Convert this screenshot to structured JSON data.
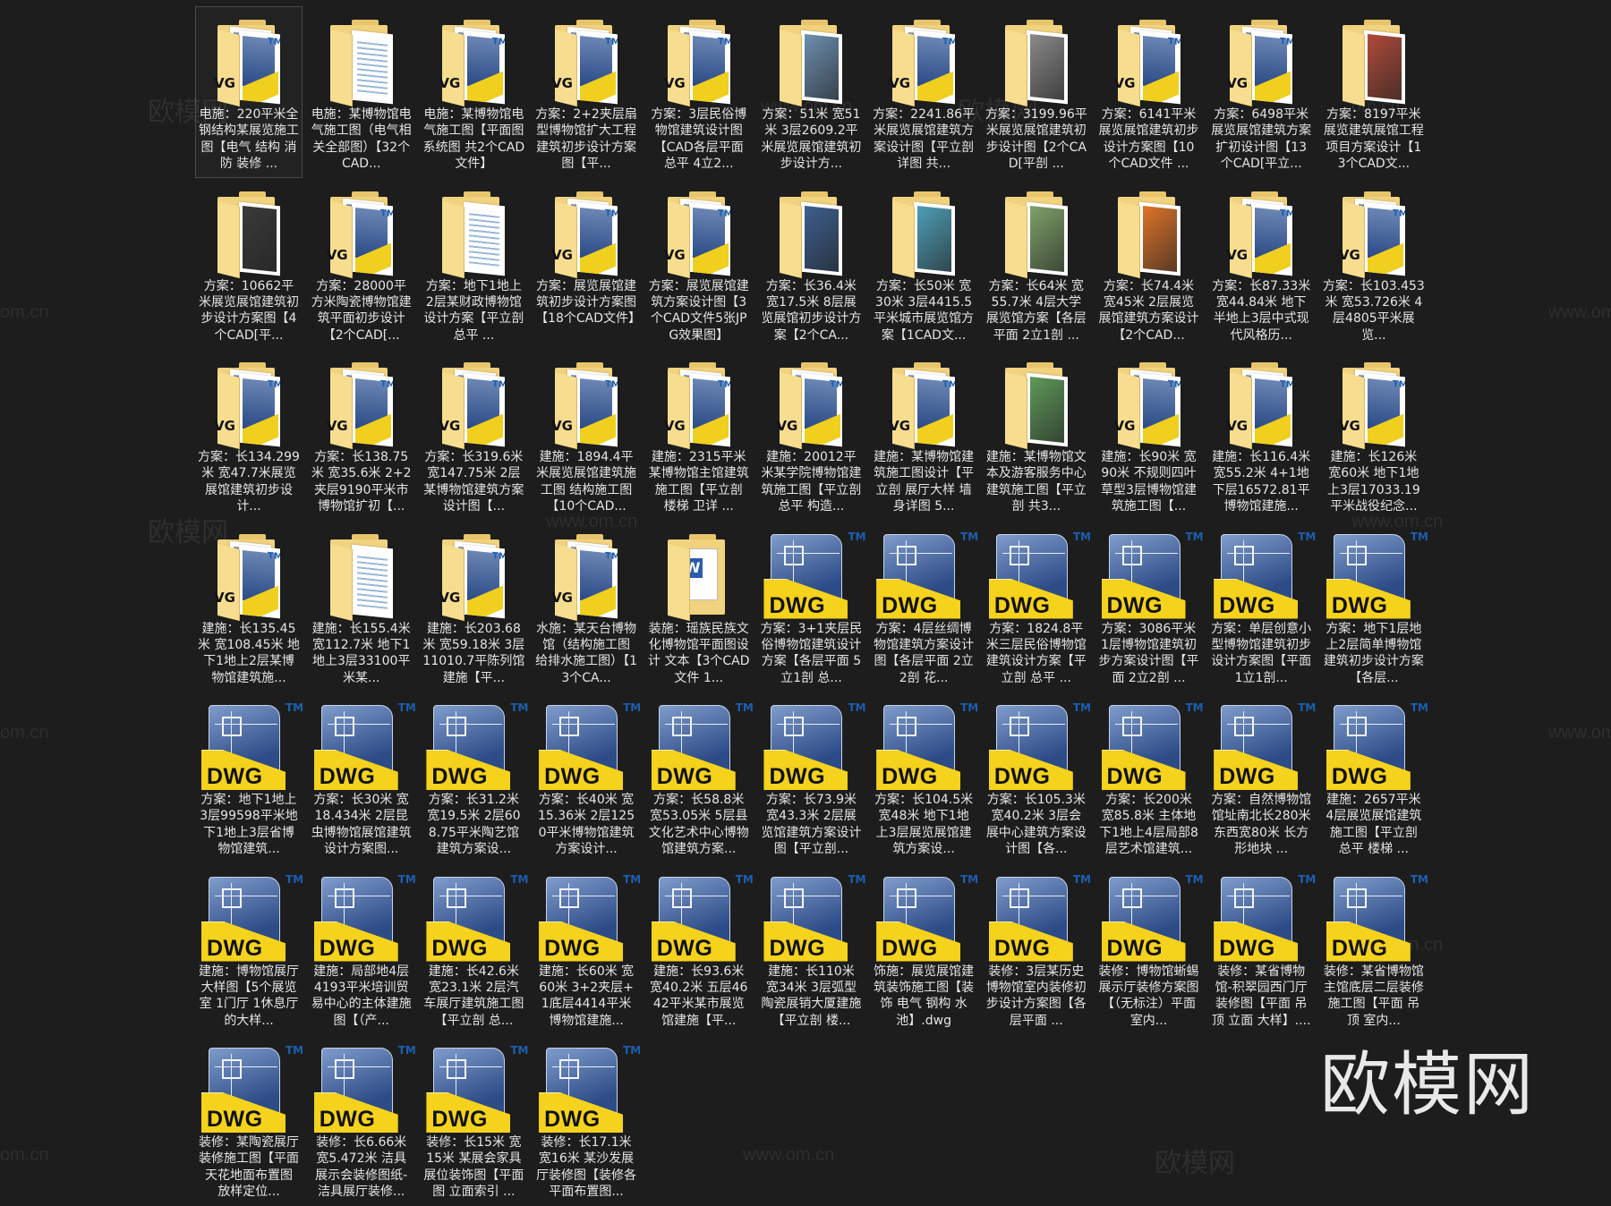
{
  "icon_text": {
    "dwg": "DWG",
    "vg": "VG",
    "tm": "TM",
    "word": "W"
  },
  "watermarks": {
    "url": "www.om.cn",
    "url_short": "om.cn",
    "brand": "欧模网"
  },
  "colors": {
    "background": "#1d1d1d",
    "label": "#e6e6e6",
    "folder": "#f0d27f",
    "dwg_blue": "#2d4b86",
    "dwg_yellow": "#f5d21c"
  },
  "selected_index": 0,
  "items": [
    {
      "type": "dwg-folder",
      "label": "电施：220平米全钢结构某展览施工图【电气 结构 消防 装修 ..."
    },
    {
      "type": "doc-folder",
      "label": "电施：某博物馆电气施工图（电气相关全部图）【32个CAD..."
    },
    {
      "type": "dwg-folder",
      "label": "电施：某博物馆电气施工图【平面图 系统图 共2个CAD文件】"
    },
    {
      "type": "dwg-folder",
      "label": "方案：2+2夹层扇型博物馆扩大工程建筑初步设计方案图【平..."
    },
    {
      "type": "dwg-folder",
      "label": "方案：3层民俗博物馆建筑设计图【CAD各层平面 总平 4立2..."
    },
    {
      "type": "image-folder",
      "preview": "#6d8fb0",
      "label": "方案：51米 宽51米 3层2609.2平米展览展馆建筑初步设计方..."
    },
    {
      "type": "dwg-folder",
      "label": "方案：2241.86平米展览展馆建筑方案设计图【平立剖 详图 共..."
    },
    {
      "type": "image-folder",
      "preview": "#8a8a8a",
      "label": "方案：3199.96平米展览展馆建筑初步设计图【2个CAD[平剖 ..."
    },
    {
      "type": "dwg-folder",
      "label": "方案：6141平米展览展馆建筑初步设计方案图【10个CAD文件 ..."
    },
    {
      "type": "dwg-folder",
      "label": "方案：6498平米展览展馆建筑方案扩初设计图【13个CAD[平立..."
    },
    {
      "type": "image-folder",
      "preview": "#b04a3a",
      "label": "方案：8197平米展览建筑展馆工程项目方案设计【13个CAD文..."
    },
    {
      "type": "image-folder",
      "preview": "#3a3a3a",
      "label": "方案：10662平米展览展馆建筑初步设计方案图【4个CAD[平..."
    },
    {
      "type": "dwg-folder",
      "label": "方案：28000平方米陶瓷博物馆建筑平面初步设计【2个CAD[..."
    },
    {
      "type": "doc-folder",
      "label": "方案：地下1地上2层某财政博物馆设计方案【平立剖 总平 ..."
    },
    {
      "type": "dwg-folder",
      "label": "方案：展览展馆建筑初步设计方案图【18个CAD文件】"
    },
    {
      "type": "dwg-folder",
      "label": "方案：展览展馆建筑方案设计图【3个CAD文件5张JPG效果图】"
    },
    {
      "type": "image-folder",
      "preview": "#3d5f8f",
      "label": "方案：长36.4米 宽17.5米 8层展览展馆初步设计方案【2个CA..."
    },
    {
      "type": "image-folder",
      "preview": "#4f9fb8",
      "label": "方案：长50米 宽30米 3层4415.5平米城市展览馆方案【1CAD文..."
    },
    {
      "type": "image-folder",
      "preview": "#7fa36a",
      "label": "方案：长64米 宽55.7米 4层大学展览馆方案【各层平面 2立1剖 ..."
    },
    {
      "type": "image-folder",
      "preview": "#e0742a",
      "label": "方案：长74.4米 宽45米 2层展览展馆建筑方案设计【2个CAD..."
    },
    {
      "type": "dwg-folder",
      "label": "方案：长87.33米 宽44.84米 地下半地上3层中式现代风格历..."
    },
    {
      "type": "dwg-folder",
      "label": "方案：长103.453米 宽53.726米 4层4805平米展览..."
    },
    {
      "type": "dwg-folder",
      "label": "方案：长134.299米 宽47.7米展览展馆建筑初步设计..."
    },
    {
      "type": "dwg-folder",
      "label": "方案：长138.75米 宽35.6米 2+2夹层9190平米市博物馆扩初【..."
    },
    {
      "type": "dwg-folder",
      "label": "方案：长319.6米 宽147.75米 2层某博物馆建筑方案设计图【..."
    },
    {
      "type": "dwg-folder",
      "label": "建施：1894.4平米展览展馆建筑施工图 结构施工图【10个CAD..."
    },
    {
      "type": "dwg-folder",
      "label": "建施：2315平米某博物馆主馆建筑施工图【平立剖 楼梯 卫详 ..."
    },
    {
      "type": "dwg-folder",
      "label": "建施：20012平米某学院博物馆建筑施工图【平立剖 总平 构造..."
    },
    {
      "type": "dwg-folder",
      "label": "建施：某博物馆建筑施工图设计【平立剖 展厅大样 墙身详图 5..."
    },
    {
      "type": "image-folder",
      "preview": "#5f9a5a",
      "label": "建施：某博物馆文本及游客服务中心建筑施工图【平立剖 共3..."
    },
    {
      "type": "dwg-folder",
      "label": "建施：长90米 宽90米 不规则四叶草型3层博物馆建筑施工图【..."
    },
    {
      "type": "dwg-folder",
      "label": "建施：长116.4米 宽55.2米 4+1地下层16572.81平博物馆建施..."
    },
    {
      "type": "dwg-folder",
      "label": "建施：长126米 宽60米 地下1地上3层17033.19平米战役纪念..."
    },
    {
      "type": "dwg-folder",
      "label": "建施：长135.45米 宽108.45米 地下1地上2层某博物馆建筑施..."
    },
    {
      "type": "doc-folder",
      "label": "建施：长155.4米 宽112.7米 地下1地上3层33100平米某..."
    },
    {
      "type": "dwg-folder",
      "label": "建施：长203.68米 宽59.18米 3层11010.7平陈列馆建施【平..."
    },
    {
      "type": "dwg-folder",
      "label": "水施：某天台博物馆（结构施工图 给排水施工图）【13个CA..."
    },
    {
      "type": "word-folder",
      "label": "装施：瑶族民族文化博物馆平面图设计 文本【3个CAD文件 1..."
    },
    {
      "type": "dwg-file",
      "label": "方案：3+1夹层民俗博物馆建筑设计方案【各层平面 5立1剖 总..."
    },
    {
      "type": "dwg-file",
      "label": "方案：4层丝绸博物馆建筑方案设计图【各层平面 2立2剖 花..."
    },
    {
      "type": "dwg-file",
      "label": "方案：1824.8平米三层民俗博物馆建筑设计方案【平立剖 总平 ..."
    },
    {
      "type": "dwg-file",
      "label": "方案：3086平米1层博物馆建筑初步方案设计图【平面 2立2剖 ..."
    },
    {
      "type": "dwg-file",
      "label": "方案：单层创意小型博物馆建筑初步设计方案图【平面 1立1剖..."
    },
    {
      "type": "dwg-file",
      "label": "方案：地下1层地上2层简单博物馆建筑初步设计方案【各层..."
    },
    {
      "type": "dwg-file",
      "label": "方案：地下1地上3层99598平米地下1地上3层省博物馆建筑..."
    },
    {
      "type": "dwg-file",
      "label": "方案：长30米 宽18.434米 2层昆虫博物馆展馆建筑设计方案图..."
    },
    {
      "type": "dwg-file",
      "label": "方案：长31.2米 宽19.5米 2层608.75平米陶艺馆建筑方案设..."
    },
    {
      "type": "dwg-file",
      "label": "方案：长40米 宽15.36米 2层1250平米博物馆建筑方案设计..."
    },
    {
      "type": "dwg-file",
      "label": "方案：长58.8米 宽53.05米 5层县文化艺术中心博物馆建筑方案..."
    },
    {
      "type": "dwg-file",
      "label": "方案：长73.9米 宽43.3米 2层展览馆建筑方案设计图【平立剖..."
    },
    {
      "type": "dwg-file",
      "label": "方案：长104.5米 宽48米 地下1地上3层展览展馆建筑方案设..."
    },
    {
      "type": "dwg-file",
      "label": "方案：长105.3米 宽40.2米 3层会展中心建筑方案设计图【各..."
    },
    {
      "type": "dwg-file",
      "label": "方案：长200米 宽85.8米 主体地下1地上4层局部8层艺术馆建筑..."
    },
    {
      "type": "dwg-file",
      "label": "方案：自然博物馆 馆址南北长280米东西宽80米 长方形地块 ..."
    },
    {
      "type": "dwg-file",
      "label": "建施：2657平米4层展览展馆建筑施工图【平立剖 总平 楼梯 ..."
    },
    {
      "type": "dwg-file",
      "label": "建施：博物馆展厅大样图【5个展览室 1门厅 1休息厅的大样..."
    },
    {
      "type": "dwg-file",
      "label": "建施：局部地4层4193平米培训贸易中心的主体建施图【（产..."
    },
    {
      "type": "dwg-file",
      "label": "建施：长42.6米 宽23.1米 2层汽车展厅建筑施工图【平立剖 总..."
    },
    {
      "type": "dwg-file",
      "label": "建施：长60米 宽60米 3+2夹层+1底层4414平米博物馆建施..."
    },
    {
      "type": "dwg-file",
      "label": "建施：长93.6米 宽40.2米 五层4642平米某市展览馆建施【平..."
    },
    {
      "type": "dwg-file",
      "label": "建施：长110米 宽34米 3层弧型陶瓷展销大厦建施【平立剖 楼..."
    },
    {
      "type": "dwg-file",
      "label": "饰施：展览展馆建筑装饰施工图【装饰 电气 钢构 水池】.dwg"
    },
    {
      "type": "dwg-file",
      "label": "装修：3层某历史博物馆室内装修初步设计方案图【各层平面 ..."
    },
    {
      "type": "dwg-file",
      "label": "装修：博物馆蜥蜴展示厅装修方案图【（无标注）平面 室内..."
    },
    {
      "type": "dwg-file",
      "label": "装修：某省博物馆-积翠园西门厅装修图【平面 吊顶 立面 大样】...."
    },
    {
      "type": "dwg-file",
      "label": "装修：某省博物馆主馆底层二层装修施工图【平面 吊顶 室内..."
    },
    {
      "type": "dwg-file",
      "label": "装修：某陶瓷展厅装修施工图【平面天花地面布置图 放样定位..."
    },
    {
      "type": "dwg-file",
      "label": "装修：长6.66米 宽5.472米 洁具展示会装修图纸-洁具展厅装修..."
    },
    {
      "type": "dwg-file",
      "label": "装修：长15米 宽15米 某展会家具展位装饰图【平面图 立面索引 ..."
    },
    {
      "type": "dwg-file",
      "label": "装修：长17.1米 宽16米 某沙发展厅装修图【装修各平面布置图..."
    }
  ]
}
